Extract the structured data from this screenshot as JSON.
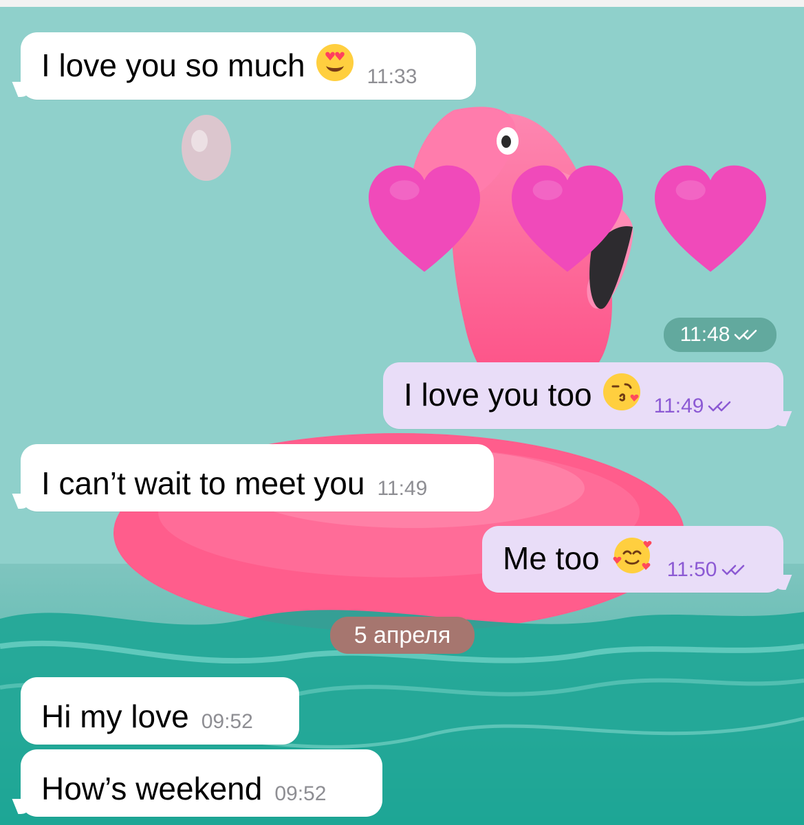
{
  "messages": [
    {
      "text": "I love you so much",
      "time": "11:33",
      "emoji": "heart-eyes-emoji"
    },
    {
      "time": "11:48",
      "hearts": [
        "pink-heart-icon",
        "pink-heart-icon",
        "pink-heart-icon"
      ]
    },
    {
      "text": "I love you too",
      "time": "11:49",
      "emoji": "kissing-face-emoji"
    },
    {
      "text": "I can’t wait to meet you",
      "time": "11:49"
    },
    {
      "text": "Me too",
      "time": "11:50",
      "emoji": "smiling-face-with-hearts-emoji"
    },
    {
      "date": "5 апреля"
    },
    {
      "text": "Hi my love",
      "time": "09:52"
    },
    {
      "text": "How’s weekend",
      "time": "09:52"
    }
  ],
  "colors": {
    "incoming_bubble": "#ffffff",
    "outgoing_bubble": "#e9ddf8",
    "outgoing_time": "#8c5ad4",
    "incoming_time": "#8e8e93",
    "time_pill": "#62a99e",
    "date_pill": "#a6766f",
    "heart_pink": "#ef4fb8"
  }
}
